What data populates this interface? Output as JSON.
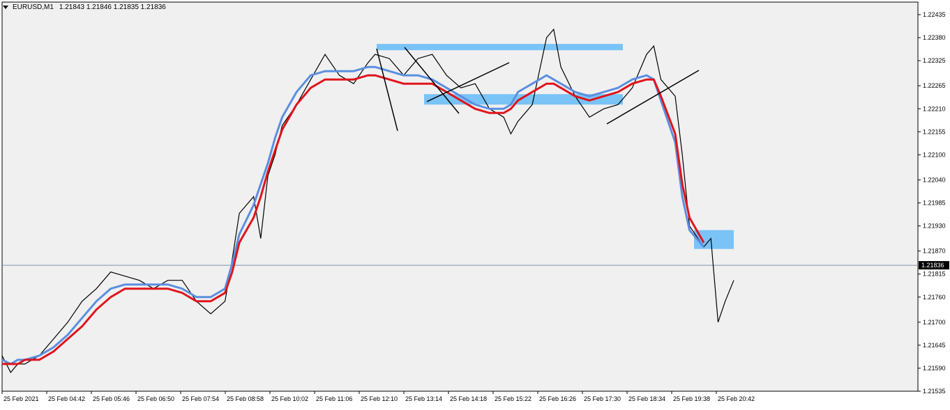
{
  "header": {
    "symbol": "EURUSD,M1",
    "ohlc": "1.21843 1.21846 1.21835 1.21836"
  },
  "colors": {
    "background": "#ffffff",
    "plot_bg": "#f0f0f0",
    "price_line": "#000000",
    "ema_fast": "#5b8fe0",
    "ema_slow": "#e0141c",
    "zone": "#79c3f7",
    "bid_line": "#7d95a8"
  },
  "chart_data": {
    "type": "line",
    "title": "EURUSD,M1",
    "current_price": 1.21836,
    "current_price_label": "1.21836",
    "ylim": [
      1.21535,
      1.22465
    ],
    "y_ticks": [
      "1.22435",
      "1.22380",
      "1.22325",
      "1.22265",
      "1.22210",
      "1.22155",
      "1.22100",
      "1.22040",
      "1.21985",
      "1.21930",
      "1.21870",
      "1.21815",
      "1.21760",
      "1.21700",
      "1.21645",
      "1.21590",
      "1.21535"
    ],
    "y_tick_values": [
      1.22435,
      1.2238,
      1.22325,
      1.22265,
      1.2221,
      1.22155,
      1.221,
      1.2204,
      1.21985,
      1.2193,
      1.2187,
      1.21815,
      1.2176,
      1.217,
      1.21645,
      1.2159,
      1.21535
    ],
    "x_ticks": [
      "25 Feb 2021",
      "25 Feb 04:42",
      "25 Feb 05:46",
      "25 Feb 06:50",
      "25 Feb 07:54",
      "25 Feb 08:58",
      "25 Feb 10:02",
      "25 Feb 11:06",
      "25 Feb 12:10",
      "25 Feb 13:14",
      "25 Feb 14:18",
      "25 Feb 15:22",
      "25 Feb 16:26",
      "25 Feb 17:30",
      "25 Feb 18:34",
      "25 Feb 19:38",
      "25 Feb 20:42"
    ],
    "price_series": {
      "x": [
        "03:38",
        "03:50",
        "04:00",
        "04:10",
        "04:30",
        "04:50",
        "05:10",
        "05:30",
        "05:50",
        "06:10",
        "06:30",
        "06:50",
        "07:10",
        "07:30",
        "07:50",
        "08:10",
        "08:30",
        "08:50",
        "09:00",
        "09:10",
        "09:30",
        "09:40",
        "09:50",
        "10:00",
        "10:10",
        "10:30",
        "10:50",
        "11:10",
        "11:30",
        "11:50",
        "12:10",
        "12:20",
        "12:40",
        "13:00",
        "13:20",
        "13:40",
        "14:00",
        "14:20",
        "14:40",
        "15:00",
        "15:20",
        "15:30",
        "15:40",
        "16:00",
        "16:20",
        "16:30",
        "16:40",
        "17:00",
        "17:20",
        "17:40",
        "18:00",
        "18:20",
        "18:40",
        "18:50",
        "19:00",
        "19:20",
        "19:30",
        "19:40",
        "20:00",
        "20:10",
        "20:20",
        "20:30",
        "20:42"
      ],
      "y": [
        1.2162,
        1.2158,
        1.216,
        1.216,
        1.2162,
        1.2166,
        1.217,
        1.2175,
        1.2178,
        1.2182,
        1.2181,
        1.218,
        1.2178,
        1.218,
        1.218,
        1.2175,
        1.2172,
        1.2175,
        1.2185,
        1.2196,
        1.22,
        1.219,
        1.2205,
        1.221,
        1.2217,
        1.2222,
        1.2228,
        1.2234,
        1.2229,
        1.2227,
        1.2232,
        1.2234,
        1.2233,
        1.2229,
        1.2233,
        1.2234,
        1.2229,
        1.2226,
        1.2227,
        1.2221,
        1.2219,
        1.2215,
        1.2218,
        1.2222,
        1.2238,
        1.224,
        1.2231,
        1.2224,
        1.2219,
        1.2221,
        1.2222,
        1.2226,
        1.2234,
        1.2236,
        1.2228,
        1.2224,
        1.221,
        1.2193,
        1.2188,
        1.219,
        1.217,
        1.2175,
        1.218
      ]
    },
    "series": [
      {
        "values": [
          1.2161,
          1.216,
          1.2161,
          1.2161,
          1.2162,
          1.2164,
          1.2167,
          1.2171,
          1.2175,
          1.2178,
          1.2179,
          1.2179,
          1.2179,
          1.2179,
          1.2178,
          1.2176,
          1.2176,
          1.2178,
          1.2184,
          1.2191,
          1.2198,
          1.2203,
          1.2208,
          1.2214,
          1.2219,
          1.2225,
          1.2229,
          1.223,
          1.223,
          1.223,
          1.2231,
          1.2231,
          1.223,
          1.2229,
          1.2229,
          1.2228,
          1.2226,
          1.2224,
          1.2222,
          1.2221,
          1.2221,
          1.2222,
          1.2225,
          1.2227,
          1.2229,
          1.2228,
          1.2227,
          1.2225,
          1.2224,
          1.2225,
          1.2226,
          1.2228,
          1.2229,
          1.2228,
          1.2223,
          1.2213,
          1.22,
          1.2192,
          1.2188
        ]
      },
      {
        "values": [
          1.216,
          1.216,
          1.216,
          1.2161,
          1.2161,
          1.2163,
          1.2166,
          1.2169,
          1.2173,
          1.2176,
          1.2178,
          1.2178,
          1.2178,
          1.2178,
          1.2177,
          1.2175,
          1.2175,
          1.2177,
          1.2182,
          1.2189,
          1.2195,
          1.22,
          1.2206,
          1.2211,
          1.2216,
          1.2222,
          1.2226,
          1.2228,
          1.2228,
          1.2228,
          1.2229,
          1.2229,
          1.2228,
          1.2227,
          1.2227,
          1.2227,
          1.2225,
          1.2223,
          1.2221,
          1.222,
          1.222,
          1.2221,
          1.2223,
          1.2225,
          1.2227,
          1.2227,
          1.2226,
          1.2224,
          1.2223,
          1.2224,
          1.2225,
          1.2227,
          1.2228,
          1.2228,
          1.2224,
          1.2215,
          1.2203,
          1.2195,
          1.2189
        ]
      }
    ],
    "zones": [
      {
        "from": 1.22365,
        "to": 1.2235
      },
      {
        "from": 1.22245,
        "to": 1.2222
      },
      {
        "from": 1.2192,
        "to": 1.21875
      }
    ]
  }
}
